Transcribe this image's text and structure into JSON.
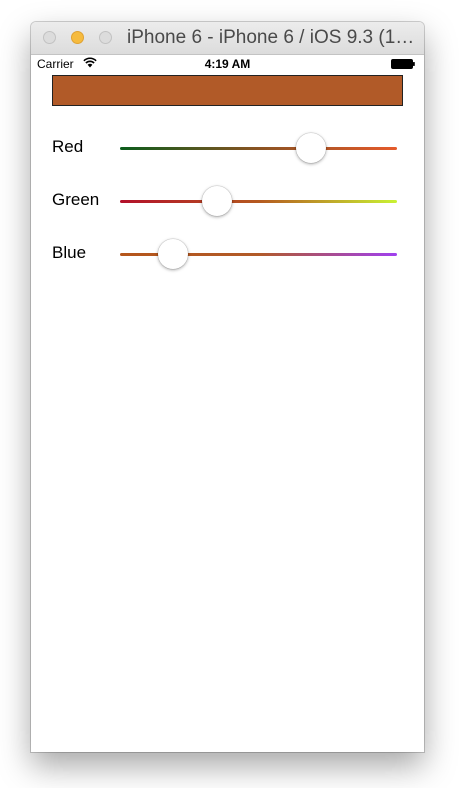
{
  "window": {
    "title": "iPhone 6 - iPhone 6 / iOS 9.3 (1…"
  },
  "status_bar": {
    "carrier": "Carrier",
    "time": "4:19 AM"
  },
  "preview_color": "#b15a28",
  "sliders": [
    {
      "label": "Red",
      "value": 0.69,
      "min_color": "#0b5c1c",
      "mid_color": "#8a5322",
      "max_color": "#e55a2b"
    },
    {
      "label": "Green",
      "value": 0.35,
      "min_color": "#b3102a",
      "mid_color": "#b5591f",
      "max_color": "#c9f233"
    },
    {
      "label": "Blue",
      "value": 0.19,
      "min_color": "#b5561b",
      "mid_color": "#b15a28",
      "max_color": "#a040f0"
    }
  ]
}
